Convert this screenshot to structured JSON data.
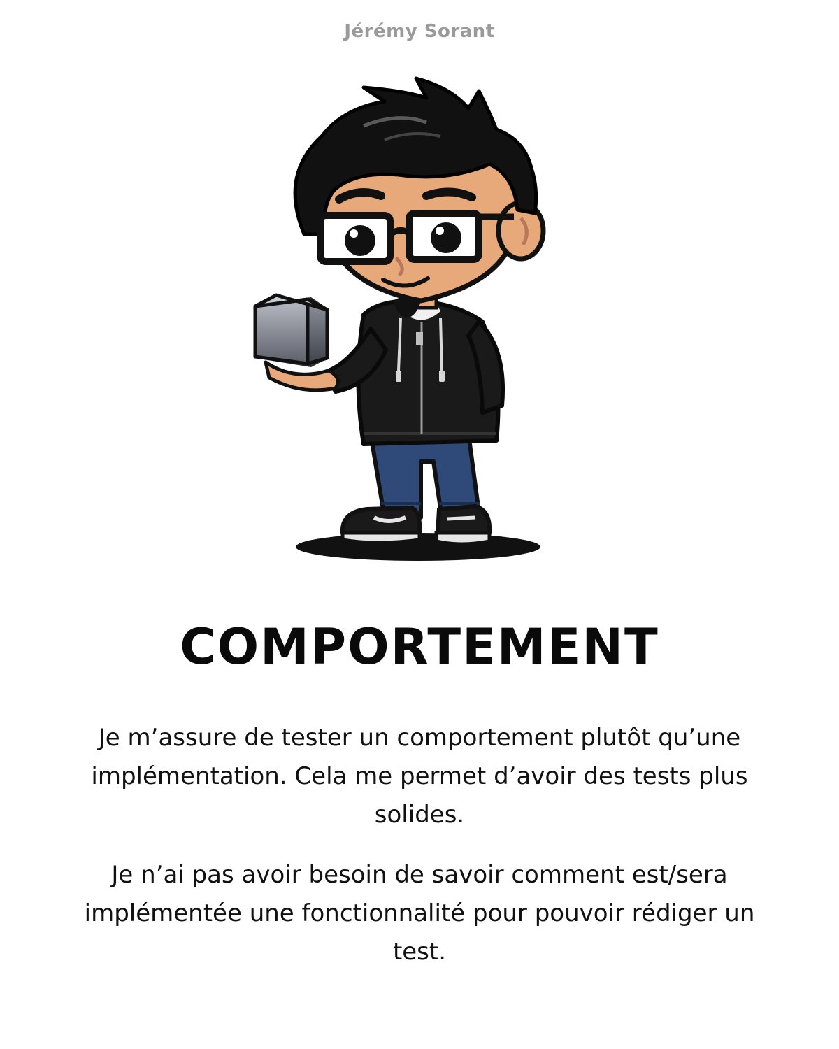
{
  "header": {
    "author": "Jérémy Sorant"
  },
  "illustration": {
    "subject": "cartoon-developer-avatar",
    "colors": {
      "hair": "#111111",
      "skin": "#e8a97a",
      "hoodie": "#1a1a1a",
      "jeans": "#2f4a78",
      "cube": "#8a8e99"
    }
  },
  "main": {
    "title": "COMPORTEMENT",
    "paragraphs": [
      "Je m’assure de tester un comportement plutôt qu’une implémentation. Cela me permet d’avoir des tests plus solides.",
      "Je n’ai pas avoir besoin de savoir comment est/sera implémentée une fonctionnalité pour pouvoir rédiger un test."
    ]
  }
}
